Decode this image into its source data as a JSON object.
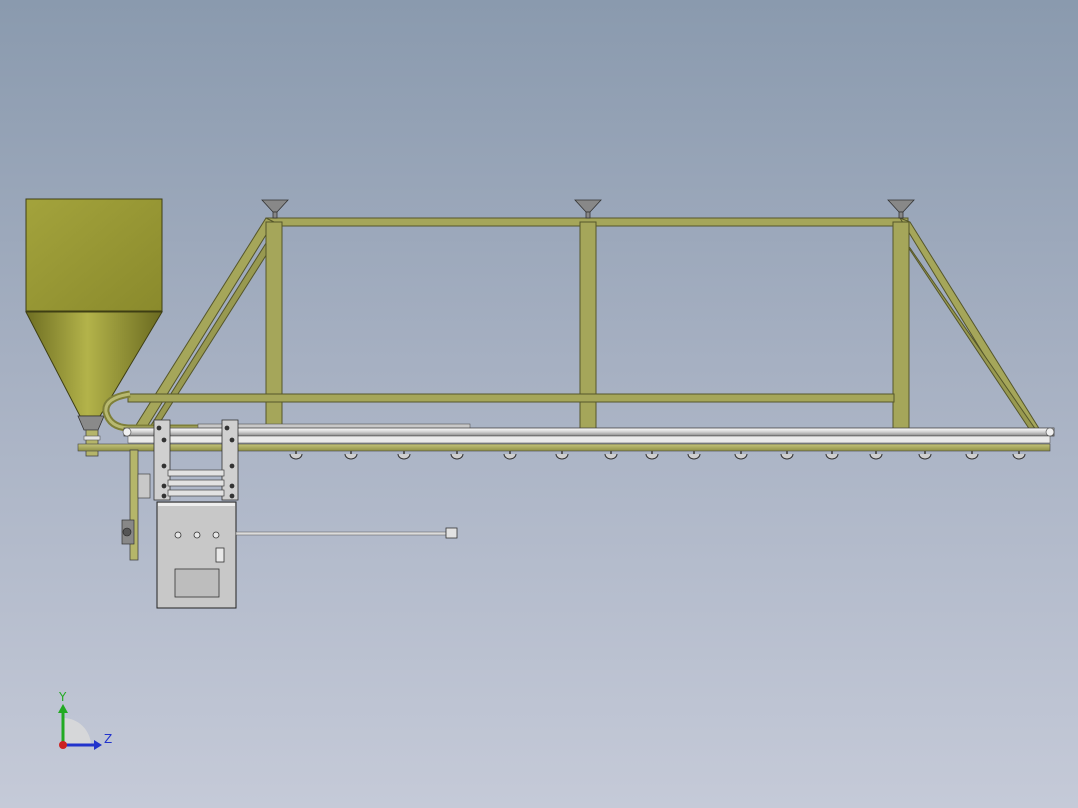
{
  "viewport": {
    "background_top": "#8a9aae",
    "background_bottom": "#c5cad8",
    "frame_color": "#a5a65a",
    "frame_edge_color": "#55562a",
    "hopper_color": "#9a9a35",
    "rail_color": "#e8e8e8",
    "cabinet_color": "#c8c8c8"
  },
  "triad": {
    "y_label": "Y",
    "z_label": "Z",
    "y_color": "#22aa22",
    "z_color": "#2233cc",
    "x_color": "#cc2222"
  }
}
